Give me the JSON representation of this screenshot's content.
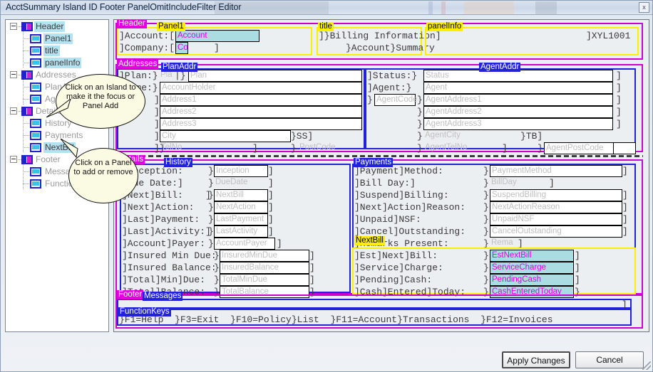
{
  "window": {
    "title": "AcctSummary Island ID Footer PanelOmitIncludeFilter Editor",
    "close_label": "x"
  },
  "tree": {
    "items": [
      {
        "label": "Header",
        "type": "island",
        "selected": true,
        "depth": 0
      },
      {
        "label": "Panel1",
        "type": "panel",
        "selected": true,
        "depth": 1
      },
      {
        "label": "title",
        "type": "panel",
        "selected": true,
        "depth": 1
      },
      {
        "label": "panelInfo",
        "type": "panel",
        "selected": true,
        "depth": 1
      },
      {
        "label": "Addresses",
        "type": "island",
        "selected": false,
        "depth": 0
      },
      {
        "label": "PlanAddr",
        "type": "panel",
        "selected": false,
        "depth": 1
      },
      {
        "label": "AgentAddr",
        "type": "panel",
        "selected": false,
        "depth": 1
      },
      {
        "label": "Details",
        "type": "island",
        "selected": false,
        "depth": 0
      },
      {
        "label": "History",
        "type": "panel",
        "selected": false,
        "depth": 1
      },
      {
        "label": "Payments",
        "type": "panel",
        "selected": false,
        "depth": 1
      },
      {
        "label": "NextBill",
        "type": "panel",
        "selected": true,
        "depth": 1
      },
      {
        "label": "Footer",
        "type": "island",
        "selected": false,
        "depth": 0
      },
      {
        "label": "Messages",
        "type": "panel",
        "selected": false,
        "depth": 1
      },
      {
        "label": "FunctionKeys",
        "type": "panel",
        "selected": false,
        "depth": 1
      }
    ]
  },
  "callouts": [
    {
      "id": "island-callout",
      "text": "Click on an Island to make it the focus or Panel Add"
    },
    {
      "id": "panel-callout",
      "text": "Click on a Panel to add or remove"
    }
  ],
  "editor": {
    "tags": {
      "header": "Header",
      "panel1": "Panel1",
      "title": "title",
      "panelinfo": "panelInfo",
      "addresses": "Addresses",
      "planaddr": "PlanAddr",
      "agentaddr": "AgentAddr",
      "details": "Details",
      "history": "History",
      "payments": "Payments",
      "nextbill": "NextBill",
      "footer": "Footer",
      "messages": "Messages",
      "functionkeys": "FunctionKeys"
    },
    "header_rows": [
      {
        "label": "]Account:[",
        "field": "Account"
      },
      {
        "label": "]Company:[",
        "field": "Co"
      }
    ],
    "title_rows": [
      {
        "text": "]}Billing Information]"
      },
      {
        "text": "}Account}Summary"
      }
    ],
    "panelinfo_rows": [
      {
        "text": "]XYL1001"
      }
    ],
    "planaddr_rows": [
      {
        "label": "]Plan:}",
        "f1": "Pla",
        "f2": "Plan"
      },
      {
        "label": "]Name:}",
        "f2": "AccountHolder"
      },
      {
        "label": "]}",
        "f2": "Address1"
      },
      {
        "label": "]}",
        "f2": "Address2"
      },
      {
        "label": "]}",
        "f2": "Address3"
      },
      {
        "label": "]}",
        "f2": "City",
        "tail": "}SS]"
      },
      {
        "label": "]}",
        "f2": "TelNo",
        "tail": "}",
        "f3": "PostCode"
      }
    ],
    "agentaddr_rows": [
      {
        "label": "]Status:}",
        "f": "Status",
        "close": "]"
      },
      {
        "label": "]Agent:}",
        "f": "Agent",
        "close": "]"
      },
      {
        "label": "}",
        "code": "AgentCode",
        "f": "AgentAddress1",
        "close": "]"
      },
      {
        "label": "}",
        "f": "AgentAddress2",
        "close": "]"
      },
      {
        "label": "}",
        "f": "AgentAddress3",
        "close": "]"
      },
      {
        "label": "}",
        "f": "AgentCity",
        "tail": "}TB]"
      },
      {
        "label": "}",
        "f": "AgentTelNo",
        "tail": "}",
        "f3": "AgentPostCode"
      }
    ],
    "history_rows": [
      {
        "label": "]Inception:",
        "f": "Inception",
        "close": "]"
      },
      {
        "label": "]Due Date:]",
        "f": "DueDate",
        "close": "]"
      },
      {
        "label": "]Next]Bill:    ]",
        "f": "NextBill",
        "close": "]"
      },
      {
        "label": "]Next]Action:",
        "f": "NextAction",
        "close": "]"
      },
      {
        "label": "]Last]Payment:",
        "f": "LastPayment",
        "close": "]"
      },
      {
        "label": "]Last]Activity:]",
        "f": "LastActivity",
        "close": "]"
      },
      {
        "label": "]Account]Payer:",
        "f": "AccountPayer",
        "close": "]"
      },
      {
        "label": "]Insured Min Due:",
        "f": "InsuredMinDue",
        "close": "]"
      },
      {
        "label": "]Insured Balance:",
        "f": "InsuredBalance",
        "close": "]"
      },
      {
        "label": "]Total]Min]Due:",
        "f": "TotalMinDue",
        "close": "]"
      },
      {
        "label": "]Total]Balance:",
        "f": "TotalBalance",
        "close": "]"
      }
    ],
    "payments_rows": [
      {
        "label": "]Payment]Method:",
        "f": "PaymentMethod",
        "close": "]"
      },
      {
        "label": "]Bill Day:]",
        "f": "BillDay",
        "close": "]"
      },
      {
        "label": "]Suspend]Billing:",
        "f": "SuspendBilling",
        "close": "]"
      },
      {
        "label": "]Next]Action]Reason:",
        "f": "NextActionReason",
        "close": "]"
      },
      {
        "label": "]Unpaid]NSF:",
        "f": "UnpaidNSF",
        "close": "]"
      },
      {
        "label": "]Cancel]Outstanding:",
        "f": "CancelOutstanding",
        "close": "]"
      },
      {
        "label": "]Remarks Present:",
        "f": "Rema",
        "close": "]"
      }
    ],
    "nextbill_rows": [
      {
        "label": "]Est]Next]Bill:",
        "f": "EstNextBill",
        "close": "]"
      },
      {
        "label": "]Service]Charge:",
        "f": "ServiceCharge",
        "close": "]"
      },
      {
        "label": "]Pending]Cash:",
        "f": "PendingCash",
        "close": "]"
      },
      {
        "label": "]Cash]Entered]Today:",
        "f": "CashEnteredToday",
        "close": "}"
      }
    ],
    "functionkeys_row": "}F1=Help  }F3=Exit  }F10=Policy}List  }F11=Account}Transactions  }F12=Invoices"
  },
  "footer_buttons": {
    "apply": "Apply Changes",
    "cancel": "Cancel"
  }
}
